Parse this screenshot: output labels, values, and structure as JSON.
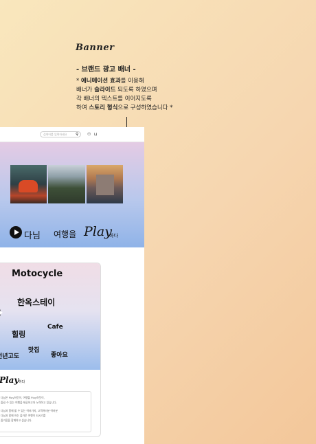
{
  "annotation": {
    "heading": "Banner",
    "subtitle": "- 브랜드 광고 배너 -",
    "line1_prefix": "* ",
    "line1_bold": "애니메이션 효과",
    "line1_rest": "를 이용해",
    "line2_pre": "배너가 ",
    "line2_bold": "슬라이드",
    "line2_rest": " 되도록 하였으며",
    "line3": "각 배너의 텍스트를 이어지도록",
    "line4_pre": "하여 ",
    "line4_bold": "스토리 형식",
    "line4_rest": "으로 구성하였습니다 *"
  },
  "site": {
    "search_placeholder": "검색어를 입력하세요",
    "banner_text1": "다님",
    "banner_text2": "여행을",
    "banner_text3": "Play",
    "banner_text4": "하다",
    "card_title": "Motocycle",
    "keywords": [
      "한옥스테이",
      "힐링",
      "Cafe",
      "맛집",
      "전년고도",
      "좋아요"
    ],
    "play_label": "Play",
    "play_small": "하다",
    "desc_lines": [
      "다님은 Play하듯이, 여행을 Play하듯이,",
      "즐길 수 있는 여행을 제공하고자 노력하고 있습니다.",
      "",
      "다님과 함께 할 수 있는 여러가지, 고객여러분 여러분",
      "다님과 함께 하는 즐거운 여행이 되시기를",
      "즐거움을 함께하고 싶습니다."
    ]
  }
}
